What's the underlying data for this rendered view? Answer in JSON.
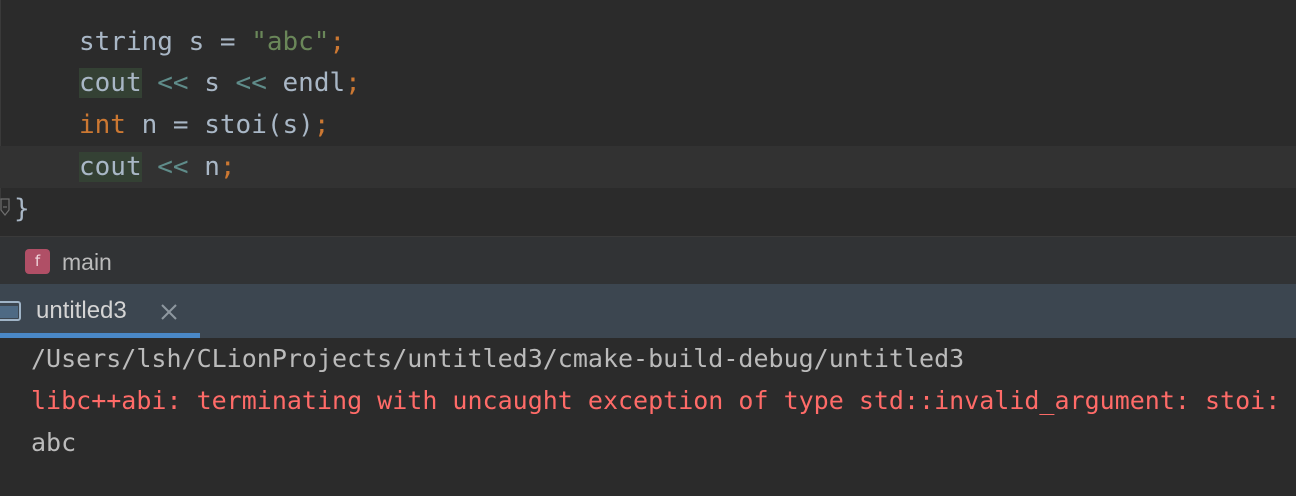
{
  "editor": {
    "lines": [
      {
        "tokens": [
          "string s = ",
          "\"abc\"",
          ";"
        ]
      },
      {
        "tokens": [
          "cout",
          " << ",
          "s",
          " << ",
          "endl",
          ";"
        ]
      },
      {
        "tokens": [
          "int",
          " n = stoi(s)",
          ";"
        ]
      },
      {
        "tokens": [
          "cout",
          " << ",
          "n",
          ";"
        ]
      },
      {
        "tokens": [
          "}"
        ]
      }
    ]
  },
  "breadcrumb": {
    "badge": "f",
    "label": "main"
  },
  "run_panel": {
    "tab_label": "untitled3",
    "output": [
      "/Users/lsh/CLionProjects/untitled3/cmake-build-debug/untitled3",
      "libc++abi: terminating with uncaught exception of type std::invalid_argument: stoi: no conversion",
      "abc"
    ]
  },
  "colors": {
    "editor_bg": "#2b2b2b",
    "keyword": "#cc7832",
    "string": "#6a8759",
    "error_text": "#ff6b68",
    "tab_accent": "#4a88c7",
    "function_badge": "#b04f66"
  }
}
